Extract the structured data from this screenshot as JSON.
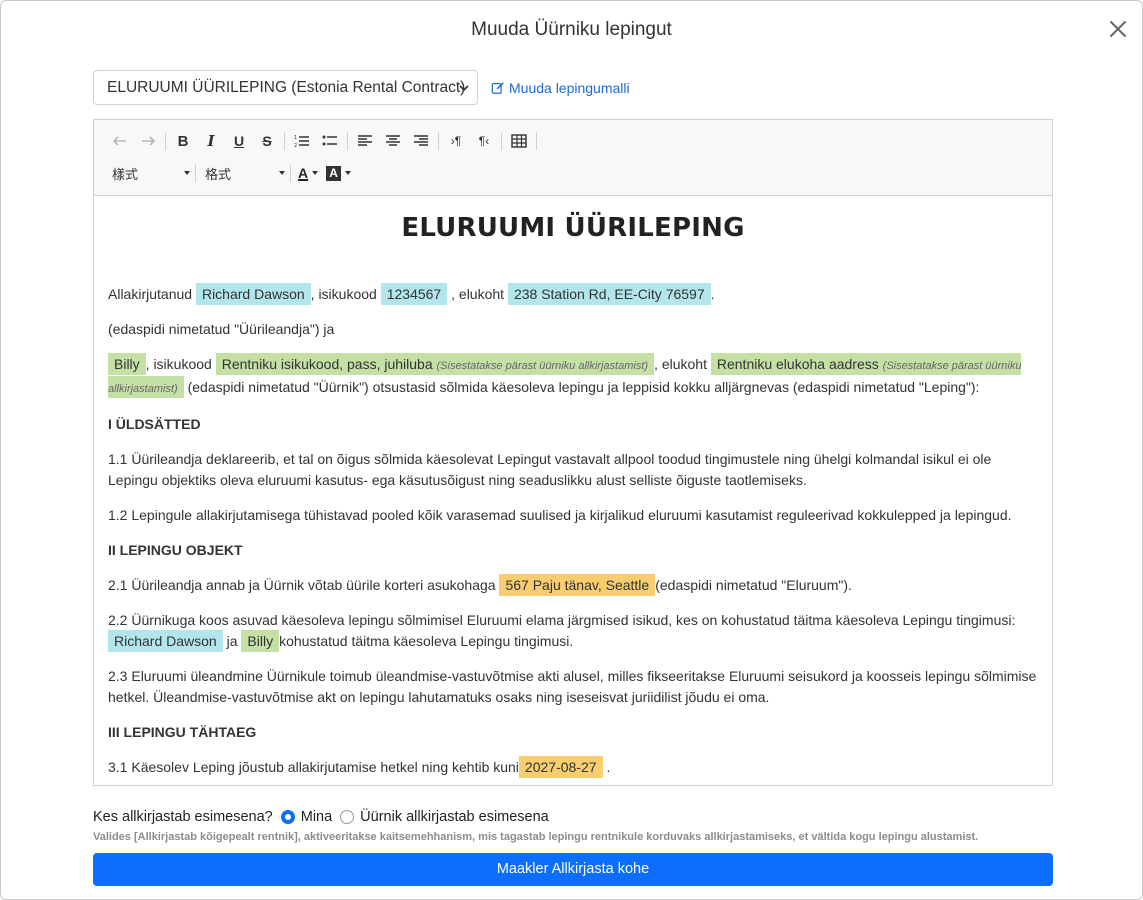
{
  "modal": {
    "title": "Muuda Üürniku lepingut",
    "close_icon": "close-icon"
  },
  "template": {
    "selected": "ELURUUMI ÜÜRILEPING (Estonia Rental Contract)",
    "edit_link": "Muuda lepingumalli"
  },
  "toolbar": {
    "style_combo": "樣式",
    "format_combo": "格式",
    "icons": [
      "undo-icon",
      "redo-icon",
      "bold-icon",
      "italic-icon",
      "underline-icon",
      "strikethrough-icon",
      "numbered-list-icon",
      "bulleted-list-icon",
      "align-left-icon",
      "align-center-icon",
      "align-right-icon",
      "ltr-icon",
      "rtl-icon",
      "table-icon",
      "text-color-icon",
      "background-color-icon"
    ]
  },
  "document": {
    "title": "ELURUUMI ÜÜRILEPING",
    "p1": {
      "t1": "Allakirjutanud",
      "landlord_name": "Richard Dawson",
      "t2": ", isikukood",
      "landlord_id": "1234567",
      "t3": ", elukoht",
      "landlord_address": "238 Station Rd, EE-City 76597",
      "t4": "."
    },
    "p2": "(edaspidi nimetatud \"Üürileandja\") ja",
    "p3": {
      "tenant_name": "Billy",
      "t1": ", isikukood",
      "tenant_id_label": "Rentniku isikukood, pass, juhiluba",
      "tenant_id_hint": "(Sisestatakse pärast üürniku allkirjastamist)",
      "t2": ", elukoht",
      "tenant_address_label": "Rentniku elukoha aadress",
      "tenant_address_hint": "(Sisestatakse pärast üürniku allkirjastamist)",
      "t3": "(edaspidi nimetatud \"Üürnik\") otsustasid sõlmida käesoleva lepingu ja leppisid kokku alljärgnevas (edaspidi nimetatud \"Leping\"):"
    },
    "h1": "I ÜLDSÄTTED",
    "p11": "1.1 Üürileandja deklareerib, et tal on õigus sõlmida käesolevat Lepingut vastavalt allpool toodud tingimustele ning ühelgi kolmandal isikul ei ole Lepingu objektiks oleva eluruumi kasutus- ega käsutusõigust ning seaduslikku alust selliste õiguste taotlemiseks.",
    "p12": "1.2 Lepingule allakirjutamisega tühistavad pooled kõik varasemad suulised ja kirjalikud eluruumi kasutamist reguleerivad kokkulepped ja lepingud.",
    "h2": "II LEPINGU OBJEKT",
    "p21": {
      "t1": "2.1 Üürileandja annab ja Üürnik võtab üürile korteri asukohaga",
      "property_address": "567 Paju tänav, Seattle",
      "t2": "(edaspidi nimetatud \"Eluruum\")."
    },
    "p22": {
      "t1": "2.2 Üürnikuga koos asuvad käesoleva lepingu sõlmimisel Eluruumi elama järgmised isikud, kes on kohustatud täitma käesoleva Lepingu tingimusi:",
      "landlord_name": "Richard Dawson",
      "t2": "ja",
      "tenant_name": "Billy",
      "t3": "kohustatud täitma käesoleva Lepingu tingimusi."
    },
    "p23": "2.3 Eluruumi üleandmine Üürnikule toimub üleandmise-vastuvõtmise akti alusel, milles fikseeritakse Eluruumi seisukord ja koosseis lepingu sõlmimise hetkel. Üleandmise-vastuvõtmise akt on lepingu lahutamatuks osaks ning iseseisvat juriidilist jõudu ei oma.",
    "h3": "III LEPINGU TÄHTAEG",
    "p31": {
      "t1": "3.1 Käesolev Leping jõustub allakirjutamise hetkel ning kehtib kuni",
      "end_date": "2027-08-27",
      "t2": "."
    }
  },
  "signer": {
    "question": "Kes allkirjastab esimesena?",
    "option_me": "Mina",
    "option_tenant": "Üürnik allkirjastab esimesena",
    "selected": "Mina",
    "note": "Valides [Allkirjastab kõigepealt rentnik], aktiveeritakse kaitsemehhanism, mis tagastab lepingu rentnikule korduvaks allkirjastamiseks, et vältida kogu lepingu alustamist."
  },
  "sign_button": "Maakler Allkirjasta kohe",
  "colors": {
    "primary": "#0d6efd",
    "link": "#1a6ad8",
    "tag_blue": "#b3e5ec",
    "tag_green": "#c5e0a5",
    "tag_orange": "#f7cd70"
  }
}
